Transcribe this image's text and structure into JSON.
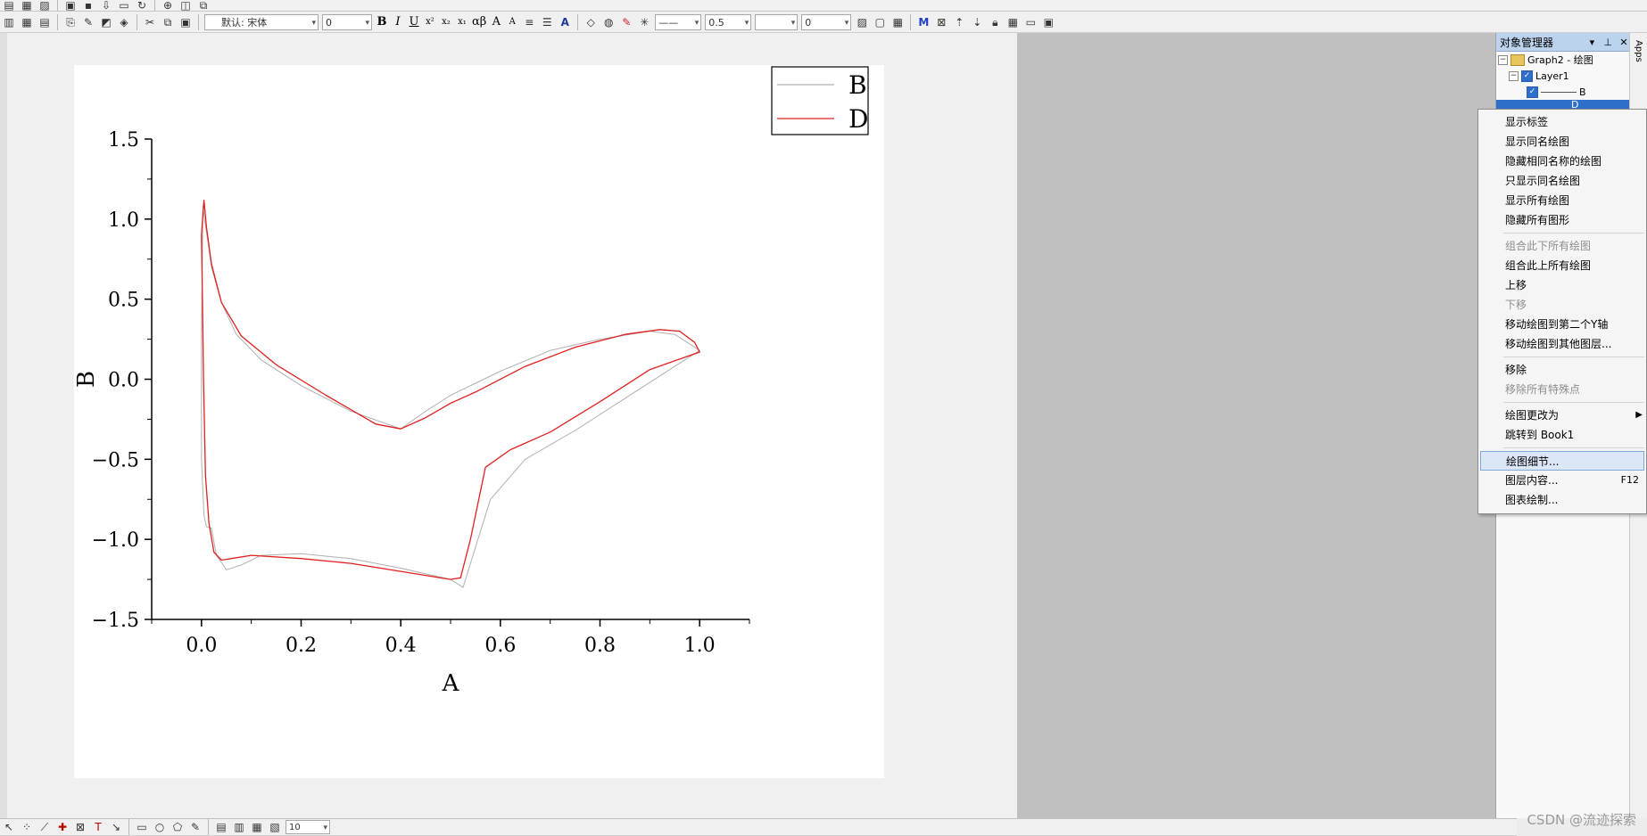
{
  "toolbar": {
    "font_name": "默认: 宋体",
    "font_size": "0",
    "line_width": "0.5",
    "pattern_size": "0",
    "bottom_size": "10",
    "format_buttons": [
      "B",
      "I",
      "U",
      "x²",
      "x₂",
      "x₁",
      "αβ",
      "A",
      "A"
    ]
  },
  "chart_data": {
    "type": "line",
    "xlabel": "A",
    "ylabel": "B",
    "xlim": [
      -0.1,
      1.1
    ],
    "ylim": [
      -1.5,
      1.5
    ],
    "xticks": [
      "0.0",
      "0.2",
      "0.4",
      "0.6",
      "0.8",
      "1.0"
    ],
    "yticks": [
      "1.5",
      "1.0",
      "0.5",
      "0.0",
      "−0.5",
      "−1.0",
      "−1.5"
    ],
    "legend_position": "top-right",
    "series": [
      {
        "name": "B",
        "color": "#b0b0b0",
        "x": [
          0.0,
          0.0,
          0.005,
          0.01,
          0.02,
          0.03,
          0.05,
          0.08,
          0.12,
          0.2,
          0.3,
          0.4,
          0.5,
          0.525,
          0.55,
          0.58,
          0.65,
          0.75,
          0.85,
          0.95,
          1.0,
          0.95,
          0.9,
          0.8,
          0.7,
          0.6,
          0.5,
          0.45,
          0.4,
          0.3,
          0.2,
          0.12,
          0.07,
          0.04,
          0.02,
          0.012,
          0.006,
          0.003,
          0.0
        ],
        "y": [
          0.3,
          -0.5,
          -0.85,
          -0.92,
          -0.93,
          -1.1,
          -1.19,
          -1.16,
          -1.1,
          -1.09,
          -1.12,
          -1.18,
          -1.25,
          -1.3,
          -1.05,
          -0.75,
          -0.5,
          -0.32,
          -0.12,
          0.08,
          0.18,
          0.28,
          0.3,
          0.25,
          0.18,
          0.05,
          -0.1,
          -0.2,
          -0.31,
          -0.2,
          -0.04,
          0.12,
          0.28,
          0.48,
          0.7,
          0.88,
          1.0,
          1.08,
          0.3
        ]
      },
      {
        "name": "D",
        "color": "#e02020",
        "x": [
          0.005,
          0.0,
          0.002,
          0.004,
          0.008,
          0.015,
          0.025,
          0.04,
          0.06,
          0.1,
          0.2,
          0.3,
          0.4,
          0.5,
          0.52,
          0.54,
          0.57,
          0.62,
          0.7,
          0.8,
          0.9,
          1.0,
          0.99,
          0.96,
          0.92,
          0.85,
          0.75,
          0.65,
          0.55,
          0.5,
          0.45,
          0.4,
          0.35,
          0.25,
          0.15,
          0.08,
          0.04,
          0.02,
          0.01,
          0.005
        ],
        "y": [
          1.12,
          0.9,
          0.5,
          0.0,
          -0.6,
          -0.9,
          -1.08,
          -1.13,
          -1.12,
          -1.1,
          -1.12,
          -1.15,
          -1.2,
          -1.25,
          -1.24,
          -1.0,
          -0.55,
          -0.44,
          -0.33,
          -0.14,
          0.06,
          0.17,
          0.23,
          0.3,
          0.31,
          0.28,
          0.2,
          0.08,
          -0.08,
          -0.15,
          -0.24,
          -0.31,
          -0.28,
          -0.1,
          0.09,
          0.27,
          0.48,
          0.72,
          0.95,
          1.12
        ]
      }
    ]
  },
  "object_manager": {
    "title": "对象管理器",
    "graph": "Graph2 - 绘图",
    "layer": "Layer1",
    "plot_b": "B",
    "plot_d": "D"
  },
  "apps_strip": "Apps",
  "context_menu": {
    "items": [
      {
        "label": "显示标签"
      },
      {
        "label": "显示同名绘图"
      },
      {
        "label": "隐藏相同名称的绘图"
      },
      {
        "label": "只显示同名绘图"
      },
      {
        "label": "显示所有绘图"
      },
      {
        "label": "隐藏所有图形"
      },
      {
        "label": "组合此下所有绘图"
      },
      {
        "label": "组合此上所有绘图"
      },
      {
        "label": "上移"
      },
      {
        "label": "下移"
      },
      {
        "label": "移动绘图到第二个Y轴"
      },
      {
        "label": "移动绘图到其他图层..."
      },
      {
        "label": "移除"
      },
      {
        "label": "移除所有特殊点"
      },
      {
        "label": "绘图更改为"
      },
      {
        "label": "跳转到 Book1"
      },
      {
        "label": "绘图细节..."
      },
      {
        "label": "图层内容...",
        "shortcut": "F12"
      },
      {
        "label": "图表绘制..."
      }
    ]
  },
  "watermark": "CSDN @流迹探索"
}
